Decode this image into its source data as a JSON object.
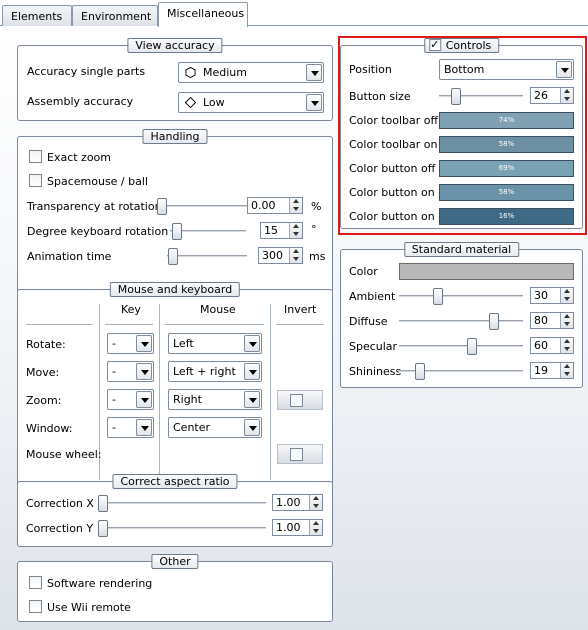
{
  "tabs": [
    "Elements",
    "Environment",
    "Miscellaneous"
  ],
  "view_accuracy": {
    "title": "View accuracy",
    "single_parts_label": "Accuracy single parts",
    "single_parts_value": "Medium",
    "assembly_label": "Assembly accuracy",
    "assembly_value": "Low"
  },
  "handling": {
    "title": "Handling",
    "exact_zoom": "Exact zoom",
    "spacemouse": "Spacemouse / ball",
    "transparency_label": "Transparency at rotation",
    "transparency_value": "0.00",
    "transparency_unit": "%",
    "degree_label": "Degree keyboard rotation",
    "degree_value": "15",
    "degree_unit": "°",
    "animation_label": "Animation time",
    "animation_value": "300",
    "animation_unit": "ms"
  },
  "mouse_keyboard": {
    "title": "Mouse and keyboard",
    "col_key": "Key",
    "col_mouse": "Mouse",
    "col_invert": "Invert",
    "rows": [
      {
        "label": "Rotate:",
        "key": "-",
        "mouse": "Left"
      },
      {
        "label": "Move:",
        "key": "-",
        "mouse": "Left + right"
      },
      {
        "label": "Zoom:",
        "key": "-",
        "mouse": "Right"
      },
      {
        "label": "Window:",
        "key": "-",
        "mouse": "Center"
      }
    ],
    "wheel_label": "Mouse wheel:"
  },
  "aspect": {
    "title": "Correct aspect ratio",
    "x_label": "Correction X",
    "x_value": "1.00",
    "y_label": "Correction Y",
    "y_value": "1.00"
  },
  "other": {
    "title": "Other",
    "software": "Software rendering",
    "wii": "Use Wii remote"
  },
  "controls": {
    "title": "Controls",
    "position_label": "Position",
    "position_value": "Bottom",
    "button_size_label": "Button size",
    "button_size_value": "26",
    "colors": [
      {
        "label": "Color toolbar off",
        "pct": "74%",
        "hex": "#7fa1b3"
      },
      {
        "label": "Color toolbar on",
        "pct": "58%",
        "hex": "#6c8fa3"
      },
      {
        "label": "Color button off",
        "pct": "69%",
        "hex": "#79a2b5"
      },
      {
        "label": "Color button on 1",
        "pct": "58%",
        "hex": "#6a92a8"
      },
      {
        "label": "Color button on 2",
        "pct": "16%",
        "hex": "#3e6a85"
      }
    ]
  },
  "material": {
    "title": "Standard material",
    "color_label": "Color",
    "color_hex": "#b8b8b8",
    "ambient_label": "Ambient",
    "ambient_value": "30",
    "diffuse_label": "Diffuse",
    "diffuse_value": "80",
    "specular_label": "Specular",
    "specular_value": "60",
    "shininess_label": "Shininess",
    "shininess_value": "19"
  }
}
